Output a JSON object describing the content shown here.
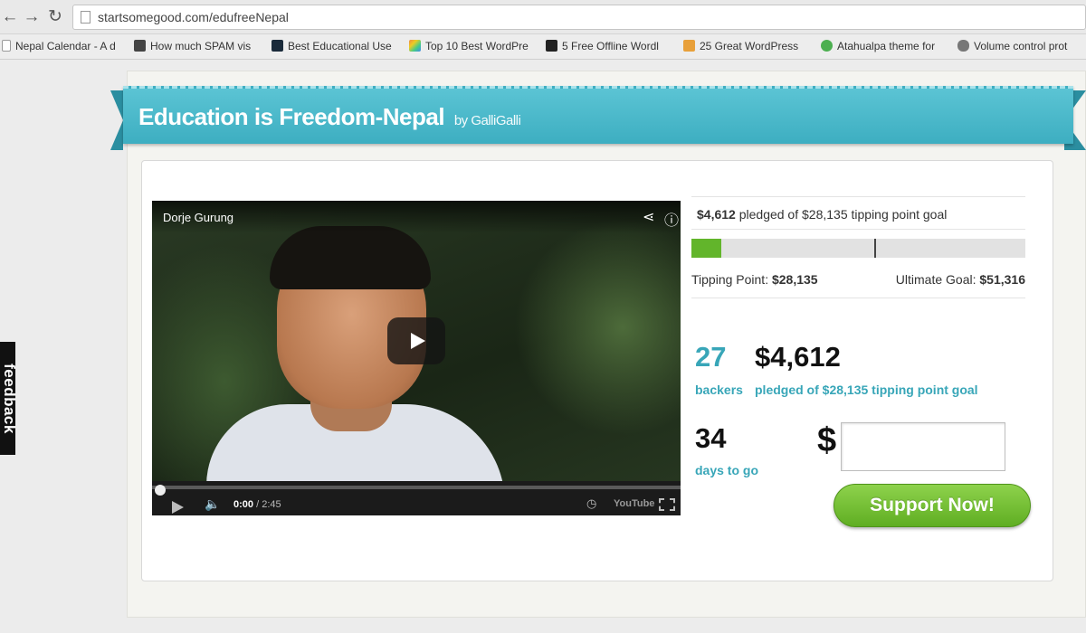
{
  "browser": {
    "url": "startsomegood.com/edufreeNepal",
    "bookmarks": [
      {
        "label": "Nepal Calendar - A d",
        "icon": "page-icon",
        "color": "#999999"
      },
      {
        "label": "How much SPAM vis",
        "icon": "news-icon",
        "color": "#444444"
      },
      {
        "label": "Best Educational Use",
        "icon": "dark-app-icon",
        "color": "#1a2a3a"
      },
      {
        "label": "Top 10 Best WordPre",
        "icon": "rainbow-icon",
        "color": "#e6a024"
      },
      {
        "label": "5 Free Offline Wordl",
        "icon": "g-icon",
        "color": "#222222"
      },
      {
        "label": "25 Great WordPress",
        "icon": "tw-icon",
        "color": "#e8a03a"
      },
      {
        "label": "Atahualpa theme for",
        "icon": "green-dot-icon",
        "color": "#4caf50"
      },
      {
        "label": "Volume control prot",
        "icon": "apple-icon",
        "color": "#777777"
      }
    ]
  },
  "feedback_label": "feedback",
  "campaign": {
    "title": "Education is Freedom-Nepal",
    "by_prefix": "by",
    "author": "GalliGalli"
  },
  "video": {
    "channel": "Dorje Gurung",
    "current_time": "0:00",
    "duration": "/ 2:45",
    "brand": "YouTube"
  },
  "funding": {
    "pledged": "$4,612",
    "pledged_text": "pledged of $28,135 tipping point goal",
    "progress_fraction": 0.09,
    "tipping_fraction": 0.548,
    "tipping_label": "Tipping Point:",
    "tipping_value": "$28,135",
    "ultimate_label": "Ultimate Goal:",
    "ultimate_value": "$51,316",
    "backers_count": "27",
    "backers_label": "backers",
    "amount_big": "$4,612",
    "amount_big_label": "pledged of $28,135 tipping point goal",
    "days_count": "34",
    "days_label": "days to go"
  },
  "support": {
    "currency": "$",
    "input_value": "",
    "button_label": "Support Now!"
  },
  "colors": {
    "accent": "#3daec1",
    "teal_text": "#38a6b8",
    "progress_green": "#62b52b"
  }
}
